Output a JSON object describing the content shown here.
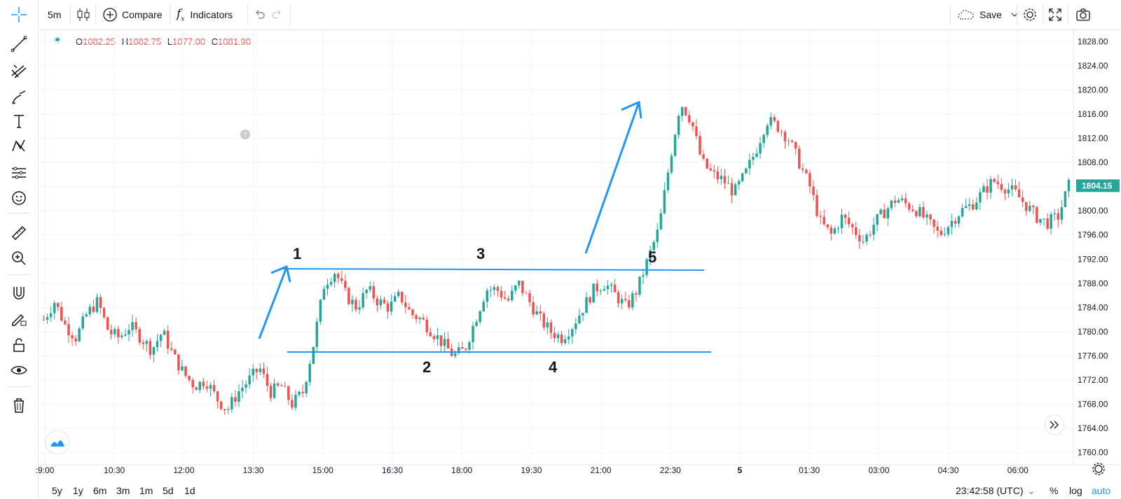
{
  "toolbar": {
    "interval": "5m",
    "compare_label": "Compare",
    "indicators_label": "Indicators",
    "save_label": "Save"
  },
  "legend": {
    "open_key": "O",
    "open": "1082.25",
    "high_key": "H",
    "high": "1082.75",
    "low_key": "L",
    "low": "1077.00",
    "close_key": "C",
    "close": "1081.90"
  },
  "price_axis": {
    "ticks": [
      "1828.00",
      "1824.00",
      "1820.00",
      "1816.00",
      "1812.00",
      "1808.00",
      "1804.00",
      "1800.00",
      "1796.00",
      "1792.00",
      "1788.00",
      "1784.00",
      "1780.00",
      "1776.00",
      "1772.00",
      "1768.00",
      "1764.00",
      "1760.00"
    ],
    "last_price": "1804.15",
    "last_price_color": "#26a69a"
  },
  "time_axis": {
    "ticks": [
      ":9:00",
      "10:30",
      "12:00",
      "13:30",
      "15:00",
      "16:30",
      "18:00",
      "19:30",
      "21:00",
      "22:30",
      "5",
      "01:30",
      "03:00",
      "04:30",
      "06:00"
    ]
  },
  "annotations": {
    "p1": "1",
    "p2": "2",
    "p3": "3",
    "p4": "4",
    "p5": "5",
    "line_color": "#2196f3"
  },
  "bottom": {
    "ranges": [
      "5y",
      "1y",
      "6m",
      "3m",
      "1m",
      "5d",
      "1d"
    ],
    "clock": "23:42:58 (UTC)",
    "percent": "%",
    "log": "log",
    "auto": "auto"
  },
  "colors": {
    "up": "#26a69a",
    "down": "#ef5350",
    "grid": "#f0f3fa"
  },
  "chart_data": {
    "type": "candlestick",
    "y_range": [
      1758,
      1830
    ],
    "close_path": [
      1782,
      1785,
      1781,
      1779,
      1783,
      1785,
      1780,
      1779,
      1781,
      1779,
      1777,
      1780,
      1776,
      1773,
      1771,
      1772,
      1769,
      1767,
      1770,
      1772,
      1774,
      1770,
      1771,
      1768,
      1770,
      1778,
      1788,
      1790,
      1786,
      1784,
      1787,
      1785,
      1784,
      1786,
      1783,
      1782,
      1780,
      1778,
      1776,
      1777,
      1782,
      1787,
      1787,
      1785,
      1788,
      1785,
      1782,
      1780,
      1779,
      1781,
      1784,
      1787,
      1788,
      1786,
      1784,
      1787,
      1792,
      1797,
      1808,
      1818,
      1815,
      1808,
      1806,
      1805,
      1803,
      1806,
      1810,
      1815,
      1814,
      1812,
      1808,
      1804,
      1798,
      1796,
      1799,
      1797,
      1795,
      1798,
      1800,
      1802,
      1801,
      1800,
      1798,
      1796,
      1798,
      1800,
      1801,
      1803,
      1805,
      1804,
      1803,
      1801,
      1799,
      1798,
      1799,
      1804.15
    ]
  }
}
